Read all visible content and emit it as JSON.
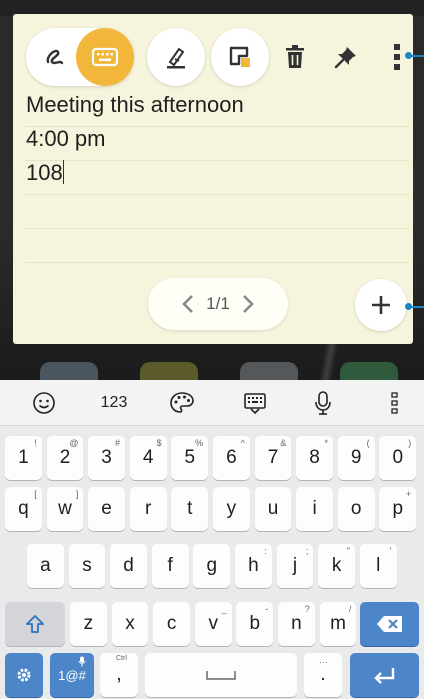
{
  "note": {
    "lines": [
      "Meeting this afternoon",
      "4:00 pm",
      "108"
    ],
    "pager": "1/1"
  },
  "toolbar": {
    "handwriting": "handwriting-mode",
    "keyboard": "keyboard-mode",
    "highlighter": "highlighter",
    "note_color": "note-color",
    "delete": "delete",
    "pin": "pin",
    "more": "more-options"
  },
  "colors": {
    "note_bg": "#f6f4dc",
    "accent_yellow": "#f2b63a",
    "key_blue": "#4d86c8",
    "callout": "#1a86c9"
  },
  "suggestions": {
    "emoji": "emoji-icon",
    "numbers": "123",
    "theme": "palette-icon",
    "clipboard": "clipboard-icon",
    "voice": "microphone-icon",
    "more": "more-icon"
  },
  "keyboard": {
    "row1": [
      {
        "k": "1",
        "h": "!"
      },
      {
        "k": "2",
        "h": "@"
      },
      {
        "k": "3",
        "h": "#"
      },
      {
        "k": "4",
        "h": "$"
      },
      {
        "k": "5",
        "h": "%"
      },
      {
        "k": "6",
        "h": "^"
      },
      {
        "k": "7",
        "h": "&"
      },
      {
        "k": "8",
        "h": "*"
      },
      {
        "k": "9",
        "h": "("
      },
      {
        "k": "0",
        "h": ")"
      }
    ],
    "row2": [
      {
        "k": "q",
        "h": "["
      },
      {
        "k": "w",
        "h": "]"
      },
      {
        "k": "e",
        "h": ""
      },
      {
        "k": "r",
        "h": ""
      },
      {
        "k": "t",
        "h": ""
      },
      {
        "k": "y",
        "h": ""
      },
      {
        "k": "u",
        "h": ""
      },
      {
        "k": "i",
        "h": ""
      },
      {
        "k": "o",
        "h": ""
      },
      {
        "k": "p",
        "h": "+"
      }
    ],
    "row3": [
      {
        "k": "a",
        "h": ""
      },
      {
        "k": "s",
        "h": ""
      },
      {
        "k": "d",
        "h": ""
      },
      {
        "k": "f",
        "h": ""
      },
      {
        "k": "g",
        "h": ""
      },
      {
        "k": "h",
        "h": ":"
      },
      {
        "k": "j",
        "h": ";"
      },
      {
        "k": "k",
        "h": "\""
      },
      {
        "k": "l",
        "h": "'"
      }
    ],
    "row4": [
      {
        "k": "z",
        "h": ""
      },
      {
        "k": "x",
        "h": ""
      },
      {
        "k": "c",
        "h": ""
      },
      {
        "k": "v",
        "h": "_"
      },
      {
        "k": "b",
        "h": "-"
      },
      {
        "k": "n",
        "h": "?"
      },
      {
        "k": "m",
        "h": "/"
      }
    ],
    "symbols_label": "1@#",
    "ctrl_hint": "Ctrl",
    "comma": ",",
    "period": ".",
    "period_hint": "…"
  }
}
